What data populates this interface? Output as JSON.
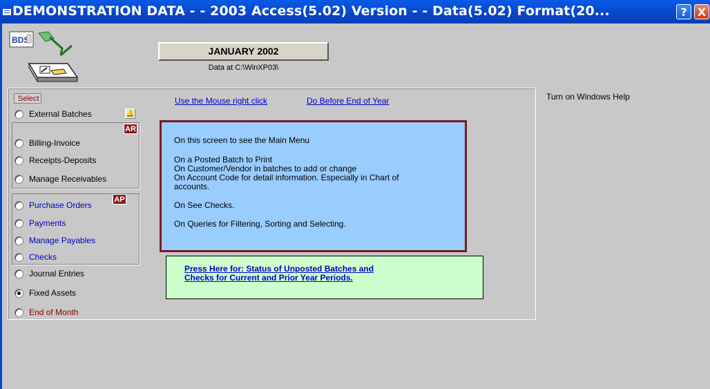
{
  "window": {
    "title": "DEMONSTRATION DATA - - 2003 Access(5.02) Version - - Data(5.02) Format(20...",
    "help_button": "?",
    "close_button": "X"
  },
  "header": {
    "logo_text": "BDS",
    "month_button": "JANUARY 2002",
    "data_path": "Data at C:\\WinXP03\\"
  },
  "links": {
    "mouse_right_click": "Use the Mouse right click",
    "before_end_of_year": "Do Before End of Year",
    "windows_help": "Turn on Windows Help"
  },
  "select": {
    "label": "Select",
    "options": [
      {
        "label": "External Batches",
        "selected": false
      },
      {
        "label": "Billing-Invoice",
        "selected": false
      },
      {
        "label": "Receipts-Deposits",
        "selected": false
      },
      {
        "label": "Manage Receivables",
        "selected": false
      },
      {
        "label": "Purchase Orders",
        "selected": false
      },
      {
        "label": "Payments",
        "selected": false
      },
      {
        "label": "Manage Payables",
        "selected": false
      },
      {
        "label": "Checks",
        "selected": false
      },
      {
        "label": "Journal Entries",
        "selected": false
      },
      {
        "label": "Fixed Assets",
        "selected": true
      },
      {
        "label": "End of Month",
        "selected": false
      }
    ],
    "ar_badge": "AR",
    "ap_badge": "AP"
  },
  "info": {
    "lines": [
      "On this screen to see the Main Menu",
      "On a Posted Batch to Print",
      "On Customer/Vendor in batches to add or change",
      "On Account Code for detail information.  Especially in Chart of",
      "accounts.",
      "On See Checks.",
      "On Queries for Filtering, Sorting and Selecting."
    ]
  },
  "status": {
    "line1": "Press Here for: Status of Unposted Batches and",
    "line2": "Checks for Current and Prior Year Periods."
  },
  "colors": {
    "titlebar": "#0a5ae8",
    "info_bg": "#99ccff",
    "info_border": "#7a1a1a",
    "status_bg": "#ccffcc",
    "badge": "#8b1a1a",
    "link": "#0000cc"
  }
}
